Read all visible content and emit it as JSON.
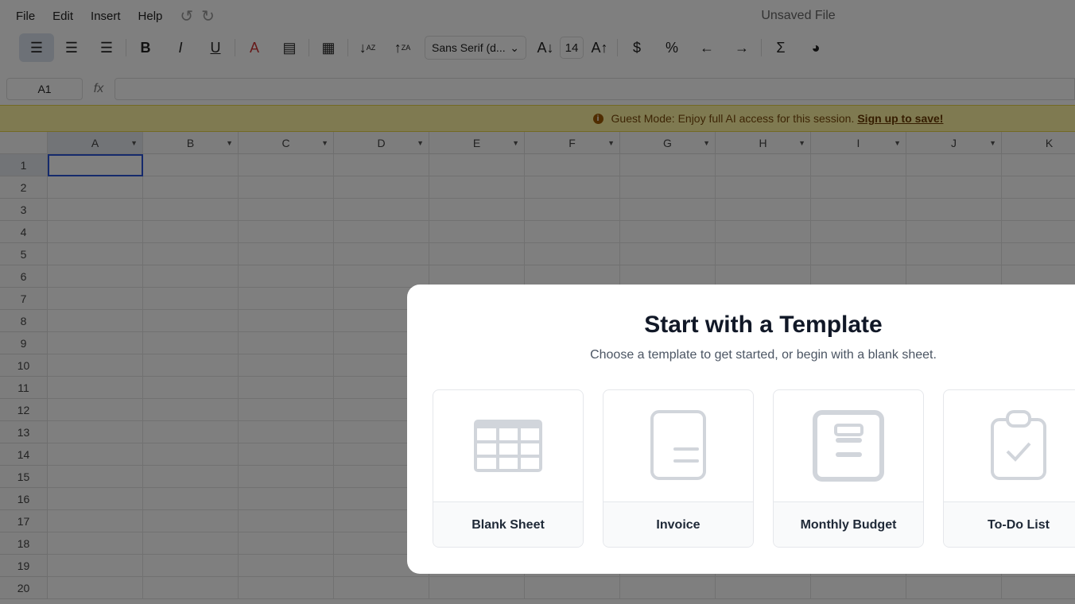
{
  "menu": [
    "File",
    "Edit",
    "Insert",
    "Help"
  ],
  "file_title": "Unsaved File",
  "toolbar": {
    "font": "Sans Serif (d...",
    "font_size": "14"
  },
  "formula": {
    "cell_ref": "A1",
    "fx": "fx",
    "value": ""
  },
  "banner": {
    "text": "Guest Mode: Enjoy full AI access for this session.",
    "link": "Sign up to save!"
  },
  "grid": {
    "columns": [
      "A",
      "B",
      "C",
      "D",
      "E",
      "F",
      "G",
      "H",
      "I",
      "J",
      "K"
    ],
    "rows": [
      "1",
      "2",
      "3",
      "4",
      "5",
      "6",
      "7",
      "8",
      "9",
      "10",
      "11",
      "12",
      "13",
      "14",
      "15",
      "16",
      "17",
      "18",
      "19",
      "20"
    ],
    "selected": "A1"
  },
  "modal": {
    "title": "Start with a Template",
    "subtitle": "Choose a template to get started, or begin with a blank sheet.",
    "templates": [
      {
        "label": "Blank Sheet",
        "icon": "table-icon"
      },
      {
        "label": "Invoice",
        "icon": "document-icon"
      },
      {
        "label": "Monthly Budget",
        "icon": "budget-icon"
      },
      {
        "label": "To-Do List",
        "icon": "clipboard-check-icon"
      }
    ]
  }
}
